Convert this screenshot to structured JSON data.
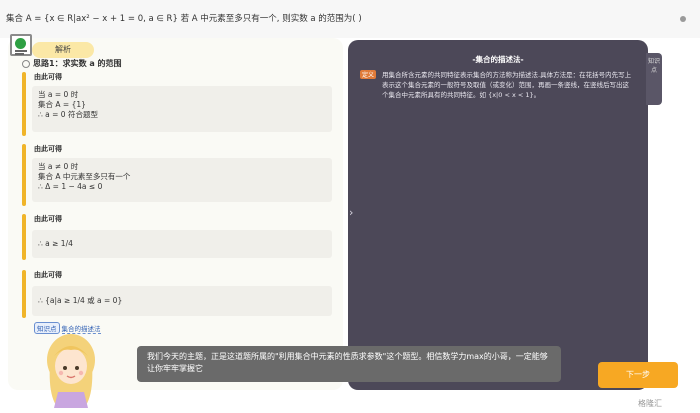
{
  "question": "集合 A = {x ∈ R|ax² − x + 1 = 0, a ∈ R} 若 A 中元素至多只有一个, 则实数 a 的范围为( )",
  "tab_label": "解析",
  "step_title": "思路1：求实数 a 的范围",
  "blocks": [
    {
      "header": "由此可得",
      "lines": [
        "当 a = 0 时",
        "集合 A = {1}",
        "∴ a = 0 符合题型"
      ]
    },
    {
      "header": "由此可得",
      "lines": [
        "当 a ≠ 0 时",
        "集合 A 中元素至多只有一个",
        "∴ Δ = 1 − 4a ≤ 0"
      ]
    },
    {
      "header": "由此可得",
      "lines": [
        "∴ a ≥ 1/4"
      ]
    },
    {
      "header": "由此可得",
      "lines": [
        "∴ {a|a ≥ 1/4 或 a = 0}"
      ]
    }
  ],
  "knowledge": {
    "tag": "知识点",
    "link": "集合的描述法"
  },
  "right_panel": {
    "title": "-集合的描述法-",
    "tag": "定义",
    "body": "用集合所含元素的共同特征表示集合的方法称为描述法.具体方法是：在花括号内先写上表示这个集合元素的一般符号及取值（或变化）范围，再画一条竖线，在竖线后写出这个集合中元素所具有的共同特征。如 {x|0 < x < 1}。",
    "side_tab": "知识点"
  },
  "speech": "我们今天的主题，正是这道题所属的\"利用集合中元素的性质求参数\"这个题型。相信数学力max的小哥，一定能够让你牢牢掌握它",
  "next_label": "下一步",
  "watermark": "格隆汇"
}
